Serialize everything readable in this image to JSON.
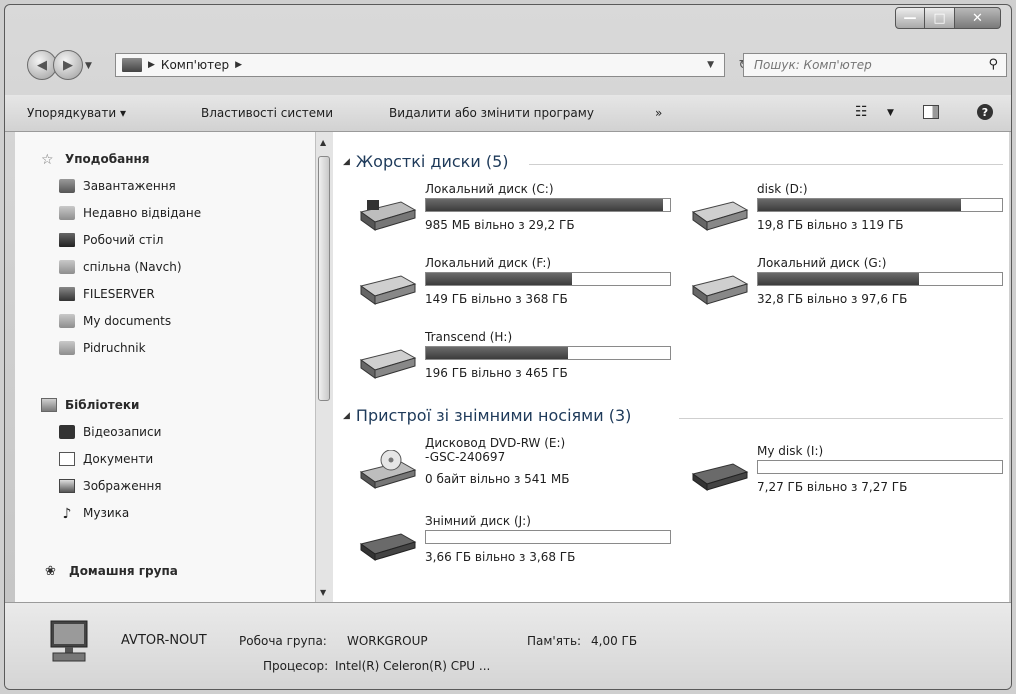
{
  "window": {
    "min_label": "—",
    "max_label": "□",
    "close_label": "✕"
  },
  "nav": {
    "address_segment": "Комп'ютер",
    "search_placeholder": "Пошук: Комп'ютер"
  },
  "toolbar": {
    "organize": "Упорядкувати ▾",
    "system_properties": "Властивості системи",
    "uninstall": "Видалити або змінити програму",
    "more": "»"
  },
  "sidebar": {
    "favorites": "Уподобання",
    "favorites_items": [
      "Завантаження",
      "Недавно відвідане",
      "Робочий стіл",
      "спільна (Navch)",
      "FILESERVER",
      "My documents",
      "Pidruchnik"
    ],
    "libraries": "Бібліотеки",
    "libraries_items": [
      "Відеозаписи",
      "Документи",
      "Зображення",
      "Музика"
    ],
    "homegroup": "Домашня група"
  },
  "groups": {
    "hard_disks": "Жорсткі диски (5)",
    "removable": "Пристрої зі знімними носіями (3)"
  },
  "drives": [
    {
      "name": "Локальний диск (C:)",
      "free": "985 МБ вільно з 29,2 ГБ",
      "used": 0.97
    },
    {
      "name": "disk (D:)",
      "free": "19,8 ГБ вільно з 119 ГБ",
      "used": 0.83
    },
    {
      "name": "Локальний диск (F:)",
      "free": "149 ГБ вільно з 368 ГБ",
      "used": 0.6
    },
    {
      "name": "Локальний диск (G:)",
      "free": "32,8 ГБ вільно з 97,6 ГБ",
      "used": 0.66
    },
    {
      "name": "Transcend (H:)",
      "free": "196 ГБ вільно з 465 ГБ",
      "used": 0.58
    }
  ],
  "removable": [
    {
      "name": "Дисковод DVD-RW (E:)",
      "sub": "-GSC-240697",
      "free": "0 байт вільно з 541 МБ"
    },
    {
      "name": "My disk (I:)",
      "free": "7,27 ГБ вільно з 7,27 ГБ",
      "used": 0.0
    },
    {
      "name": "Знімний диск (J:)",
      "free": "3,66 ГБ вільно з 3,68 ГБ",
      "used": 0.0
    }
  ],
  "status": {
    "computer_name": "AVTOR-NOUT",
    "workgroup_label": "Робоча група:",
    "workgroup": "WORKGROUP",
    "memory_label": "Пам'ять:",
    "memory": "4,00 ГБ",
    "cpu_label": "Процесор:",
    "cpu": "Intel(R) Celeron(R) CPU ..."
  }
}
